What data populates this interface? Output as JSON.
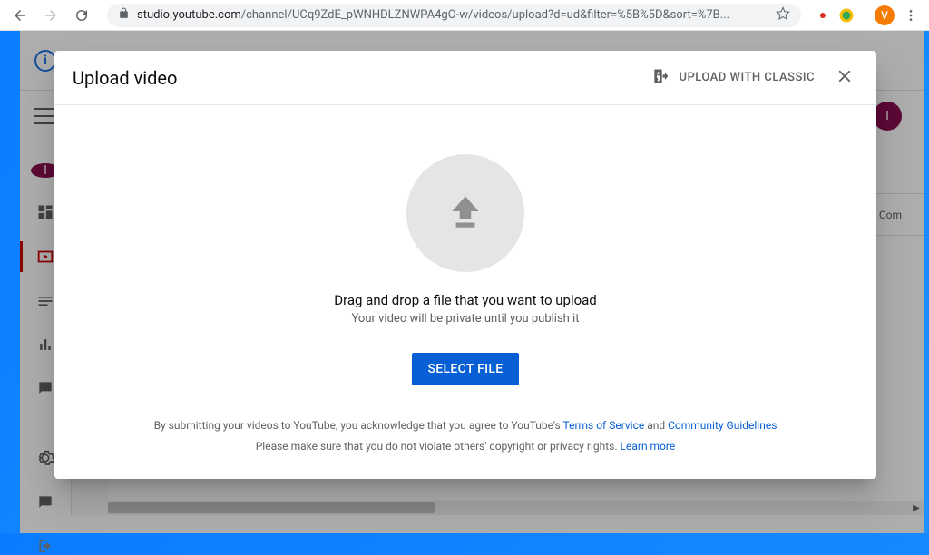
{
  "browser": {
    "url_domain": "studio.youtube.com",
    "url_path": "/channel/UCq9ZdE_pWNHDLZNWPA4gO-w/videos/upload?d=ud&filter=%5B%5D&sort=%7B...",
    "avatar_letter": "V"
  },
  "studio": {
    "sidebar_avatar": "I",
    "columns_label": "Com"
  },
  "modal": {
    "title": "Upload video",
    "classic_label": "UPLOAD WITH CLASSIC",
    "drag_text": "Drag and drop a file that you want to upload",
    "private_text": "Your video will be private until you publish it",
    "select_button": "SELECT FILE",
    "footer_pre": "By submitting your videos to YouTube, you acknowledge that you agree to YouTube's ",
    "terms_link": "Terms of Service",
    "footer_and": " and ",
    "guidelines_link": "Community Guidelines",
    "footer_line2_pre": "Please make sure that you do not violate others' copyright or privacy rights. ",
    "learn_more": "Learn more"
  }
}
